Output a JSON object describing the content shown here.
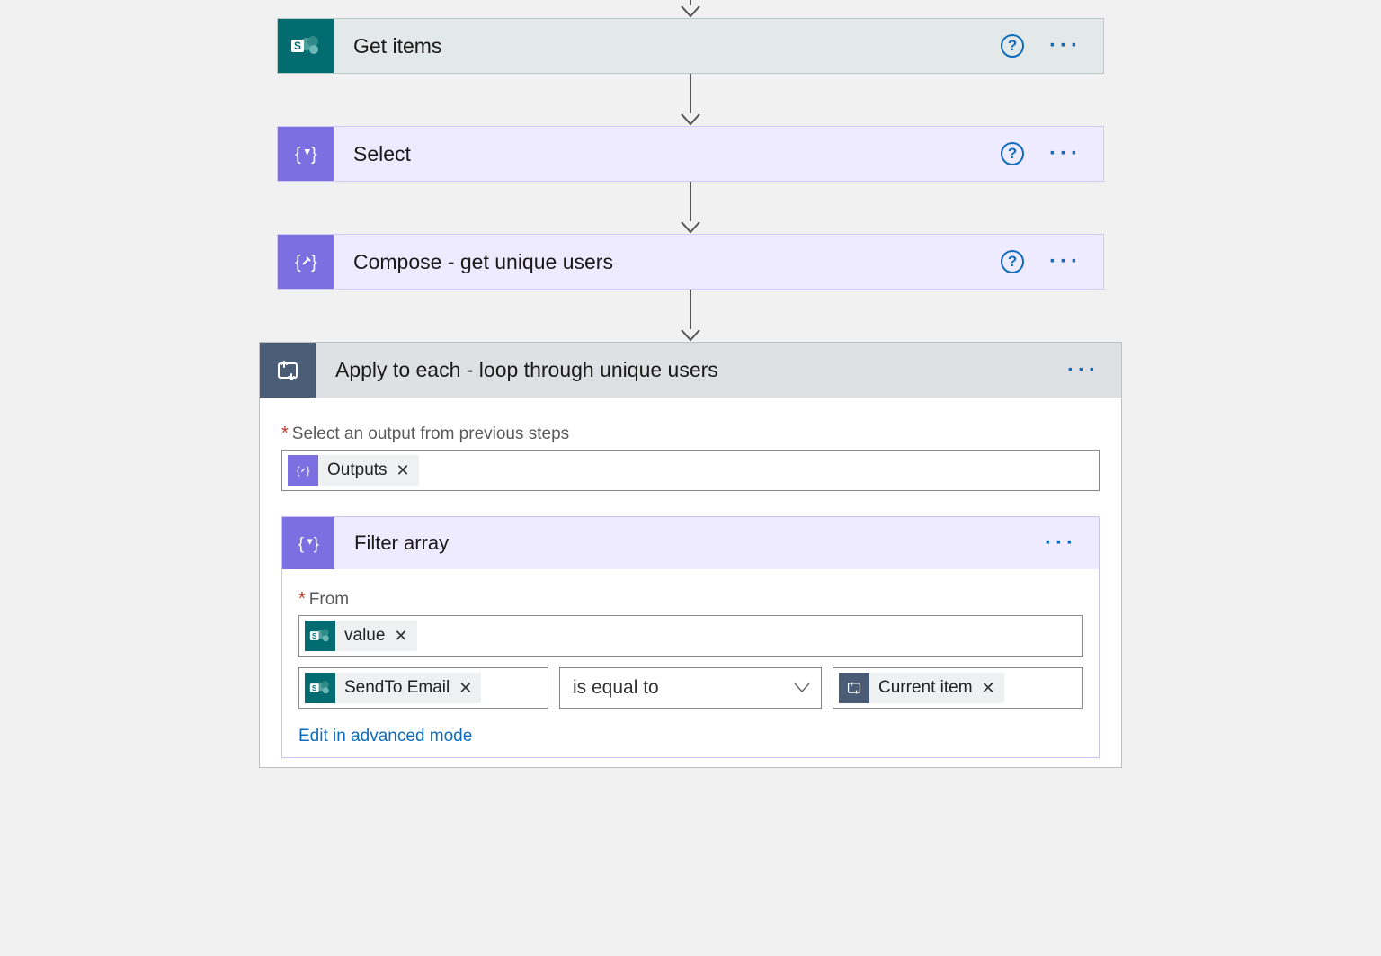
{
  "actions": {
    "get_items": {
      "title": "Get items"
    },
    "select": {
      "title": "Select"
    },
    "compose": {
      "title": "Compose - get unique users"
    },
    "apply_each": {
      "title": "Apply to each - loop through unique users",
      "output_label": "Select an output from previous steps",
      "output_token": "Outputs"
    },
    "filter_array": {
      "title": "Filter array",
      "from_label": "From",
      "from_token": "value",
      "condition": {
        "left_token": "SendTo Email",
        "operator": "is equal to",
        "right_token": "Current item"
      },
      "advanced_link": "Edit in advanced mode"
    }
  }
}
